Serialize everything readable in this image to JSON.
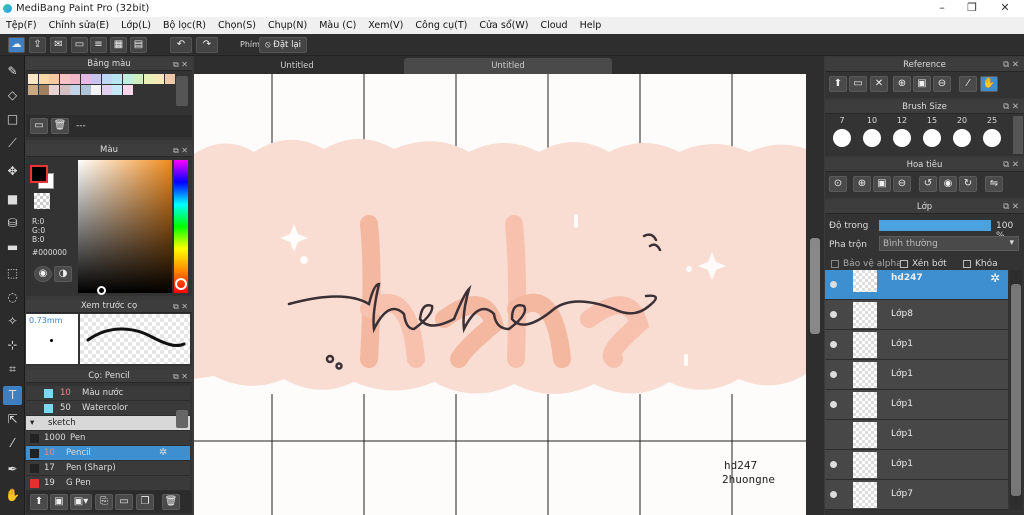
{
  "window": {
    "title": "MediBang Paint Pro (32bit)",
    "minimize": "–",
    "maximize": "❐",
    "close": "✕"
  },
  "menu": [
    "Tệp(F)",
    "Chỉnh sửa(E)",
    "Lớp(L)",
    "Bộ lọc(R)",
    "Chọn(S)",
    "Chụp(N)",
    "Màu (C)",
    "Xem(V)",
    "Công cụ(T)",
    "Cửa sổ(W)",
    "Cloud",
    "Help"
  ],
  "toolbar": {
    "shortcut_label": "Phím",
    "reset_label": "Đặt lại"
  },
  "tabs": [
    "Untitled",
    "Untitled"
  ],
  "panels": {
    "palette": {
      "title": "Bảng màu",
      "dash": "---"
    },
    "color": {
      "title": "Màu",
      "r": "R:0",
      "g": "G:0",
      "b": "B:0",
      "hex": "#000000"
    },
    "preview": {
      "title": "Xem trước cọ",
      "size": "0.73mm"
    },
    "brush": {
      "title": "Cọ: Pencil",
      "items": [
        {
          "size": "10",
          "name": "Màu nước",
          "color": "#7fd6f0"
        },
        {
          "size": "50",
          "name": "Watercolor",
          "color": "#7fd6f0"
        },
        {
          "size": "",
          "name": "sketch",
          "color": ""
        },
        {
          "size": "1000",
          "name": "Pen",
          "color": "#222222"
        },
        {
          "size": "10",
          "name": "Pencil",
          "color": "#222222"
        },
        {
          "size": "17",
          "name": "Pen (Sharp)",
          "color": "#222222"
        },
        {
          "size": "19",
          "name": "G Pen",
          "color": "#e03030"
        }
      ]
    }
  },
  "right": {
    "reference": {
      "title": "Reference"
    },
    "brush_size": {
      "title": "Brush Size",
      "sizes": [
        "7",
        "10",
        "12",
        "15",
        "20",
        "25"
      ]
    },
    "navigator": {
      "title": "Hoa tiêu"
    },
    "layers": {
      "title": "Lớp",
      "opacity_label": "Độ trong",
      "opacity_value": "100 %",
      "blend_label": "Pha trộn",
      "blend_value": "Bình thường",
      "protect_alpha": "Bảo vệ alpha",
      "clipping": "Xén bớt",
      "lock": "Khóa",
      "items": [
        "hd247",
        "Lớp8",
        "Lớp1",
        "Lớp1",
        "Lớp1",
        "Lớp1",
        "Lớp1",
        "Lớp7"
      ]
    }
  },
  "artwork": {
    "main_text": "hehe",
    "watermark_line1": "hd247",
    "watermark_line2": "2huongne"
  },
  "colors": {
    "accent": "#3d8fd0",
    "banner": "#f9dcd2"
  }
}
